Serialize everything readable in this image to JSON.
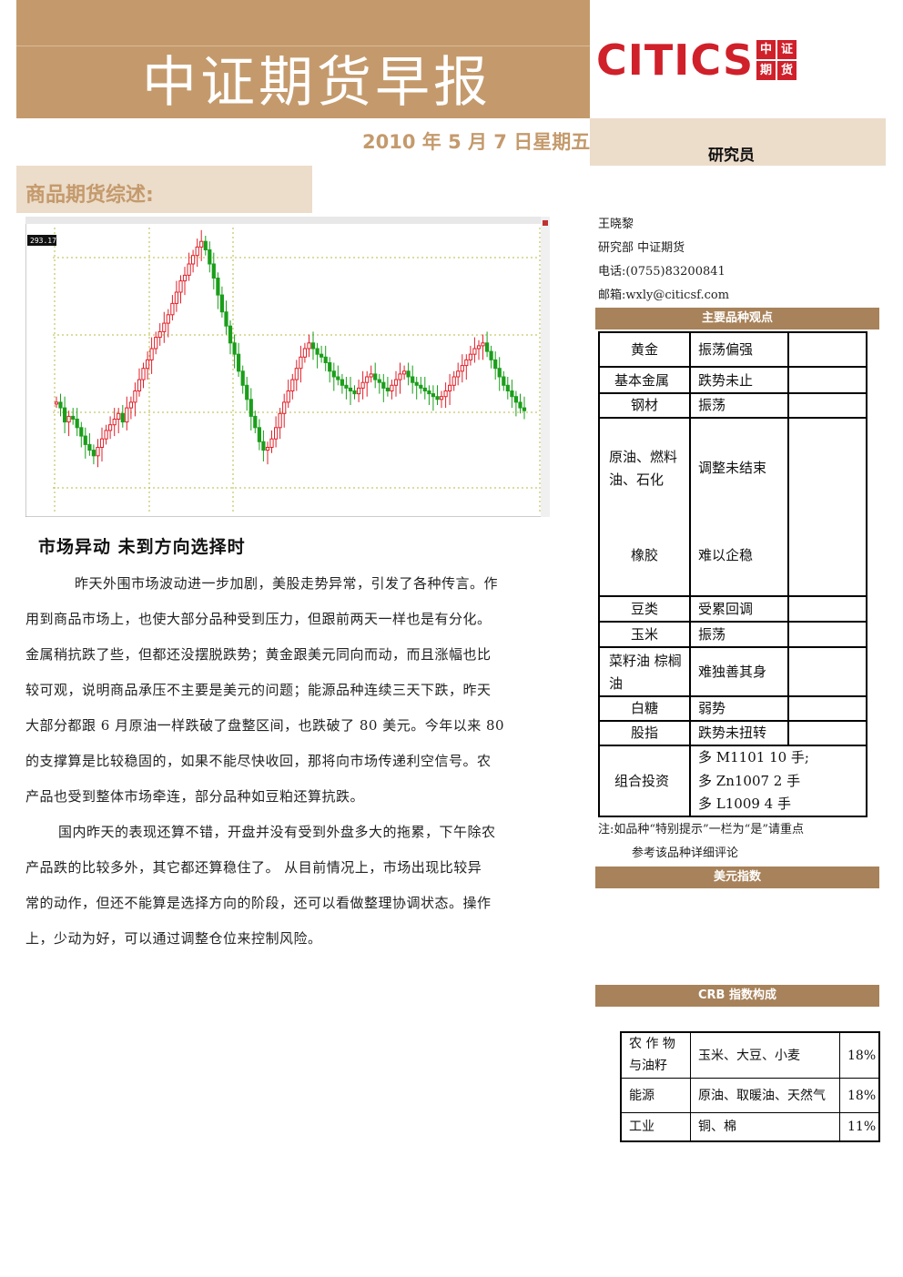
{
  "header": {
    "title": "中证期货早报",
    "date": "2010 年 5 月 7 日星期五",
    "logo_text": "CITICS",
    "logo_cn": [
      "中",
      "证",
      "期",
      "货"
    ],
    "researcher_label": "研究员"
  },
  "section": {
    "title": "商品期货综述:"
  },
  "contact": {
    "name": "王晓黎",
    "dept": "研究部 中证期货",
    "phone": "电话:(0755)83200841",
    "email": "邮箱:wxly@citicsf.com"
  },
  "views_table": {
    "header": "主要品种观点",
    "rows": [
      {
        "name": "黄金",
        "view": "振荡偏强"
      },
      {
        "name": "基本金属",
        "view": "跌势未止"
      },
      {
        "name": "钢材",
        "view": "振荡"
      },
      {
        "name": "原油、燃料油、石化",
        "view": "调整未结束"
      },
      {
        "name": "橡胶",
        "view": "难以企稳"
      },
      {
        "name": "豆类",
        "view": "受累回调"
      },
      {
        "name": "玉米",
        "view": "振荡"
      },
      {
        "name": "菜籽油 棕榈油",
        "view": "难独善其身"
      },
      {
        "name": "白糖",
        "view": "弱势"
      },
      {
        "name": "股指",
        "view": "跌势未扭转"
      },
      {
        "name": "组合投资",
        "view_lines": [
          "多 M1101 10 手;",
          "多 Zn1007 2 手",
          "多 L1009 4 手"
        ]
      }
    ],
    "note_line1": "注:如品种“特别提示”一栏为“是”请重点",
    "note_line2": "参考该品种详细评论"
  },
  "usd_index": {
    "header": "美元指数"
  },
  "crb": {
    "header": "CRB 指数构成",
    "rows": [
      {
        "cat1": "农 作 物",
        "cat2": "与油籽",
        "items": "玉米、大豆、小麦",
        "pct": "18%"
      },
      {
        "cat1": "能源",
        "cat2": "",
        "items": "原油、取暖油、天然气",
        "pct": "18%"
      },
      {
        "cat1": "工业",
        "cat2": "",
        "items": "铜、棉",
        "pct": "11%"
      }
    ]
  },
  "article": {
    "headline": "市场异动 未到方向选择时",
    "lines": [
      "昨天外围市场波动进一步加剧，美股走势异常，引发了各种传言。作",
      "用到商品市场上，也使大部分品种受到压力，但跟前两天一样也是有分化。",
      "金属稍抗跌了些，但都还没摆脱跌势；黄金跟美元同向而动，而且涨幅也比",
      "较可观，说明商品承压不主要是美元的问题；能源品种连续三天下跌，昨天",
      "大部分都跟 6 月原油一样跌破了盘整区间，也跌破了 80 美元。今年以来 80",
      "的支撑算是比较稳固的，如果不能尽快收回，那将向市场传递利空信号。农",
      "产品也受到整体市场牵连，部分品种如豆粕还算抗跌。",
      "国内昨天的表现还算不错，开盘并没有受到外盘多大的拖累，下午除农",
      "产品跌的比较多外，其它都还算稳住了。 从目前情况上，市场出现比较异",
      "常的动作，但还不能算是选择方向的阶段，还可以看做整理协调状态。操作",
      "上，少动为好，可以通过调整仓位来控制风险。"
    ]
  },
  "chart_data": {
    "type": "candlestick",
    "title": "",
    "price_label": "293.17",
    "colors": {
      "up": "#e0202a",
      "down": "#1a9e1a",
      "grid": "#b8b840"
    }
  }
}
